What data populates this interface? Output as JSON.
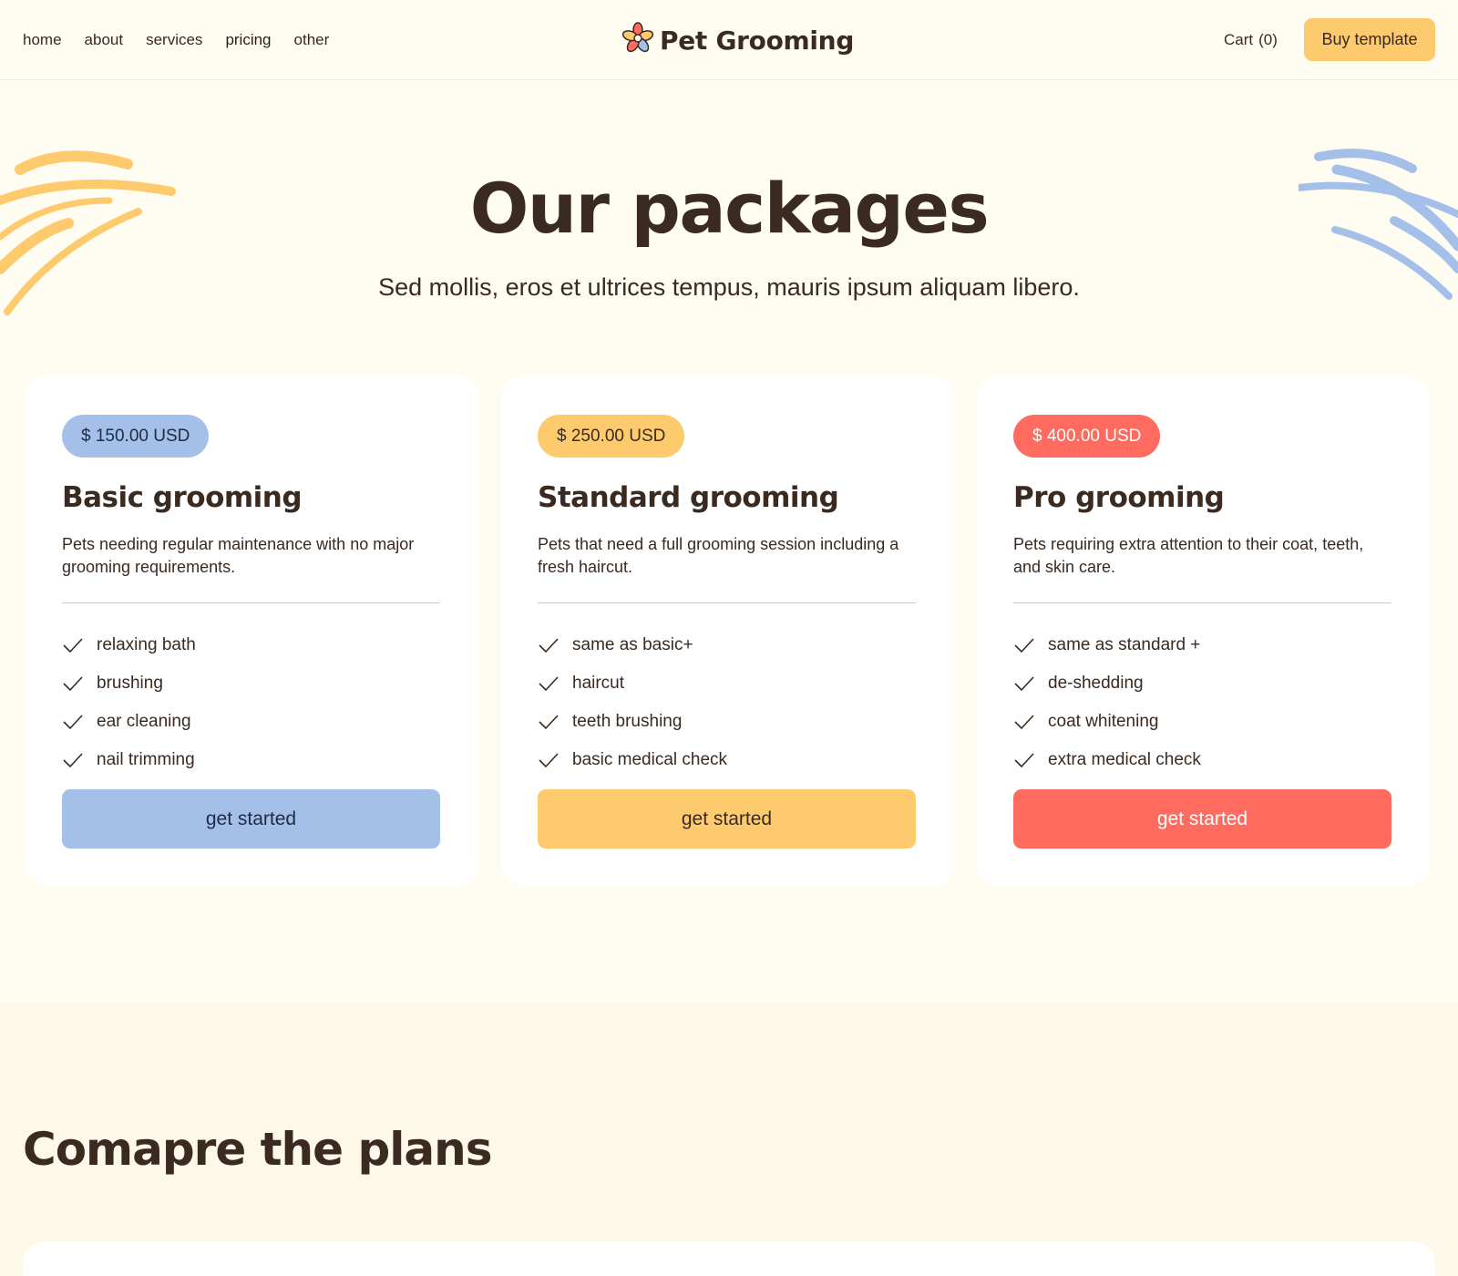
{
  "nav": {
    "items": [
      {
        "label": "home"
      },
      {
        "label": "about"
      },
      {
        "label": "services"
      },
      {
        "label": "pricing"
      },
      {
        "label": "other"
      }
    ]
  },
  "brand": {
    "name": "Pet Grooming",
    "logo_icon": "flower-paw-icon"
  },
  "header": {
    "cart_label": "Cart",
    "cart_count": "(0)",
    "buy_label": "Buy template"
  },
  "hero": {
    "title": "Our packages",
    "subtitle": "Sed mollis, eros et ultrices tempus, mauris ipsum aliquam libero."
  },
  "colors": {
    "blue": "#a4c0e8",
    "yellow": "#fdcb6e",
    "red": "#ff6b5f",
    "text": "#3a2a20",
    "background": "#fffcf2"
  },
  "packages": [
    {
      "price": "$ 150.00 USD",
      "title": "Basic grooming",
      "description": "Pets needing regular maintenance with no major grooming requirements.",
      "features": [
        "relaxing bath",
        "brushing",
        "ear cleaning",
        "nail trimming"
      ],
      "cta": "get started",
      "accent": "#a4c0e8"
    },
    {
      "price": "$ 250.00 USD",
      "title": "Standard grooming",
      "description": "Pets that need a full grooming session including a fresh haircut.",
      "features": [
        "same as basic+",
        "haircut",
        "teeth brushing",
        "basic medical check"
      ],
      "cta": "get started",
      "accent": "#fdcb6e"
    },
    {
      "price": "$ 400.00 USD",
      "title": "Pro grooming",
      "description": "Pets requiring extra attention to their coat, teeth, and skin care.",
      "features": [
        "same as standard +",
        "de-shedding",
        "coat whitening",
        "extra medical check"
      ],
      "cta": "get started",
      "accent": "#ff6b5f"
    }
  ],
  "compare": {
    "title": "Comapre the plans"
  }
}
